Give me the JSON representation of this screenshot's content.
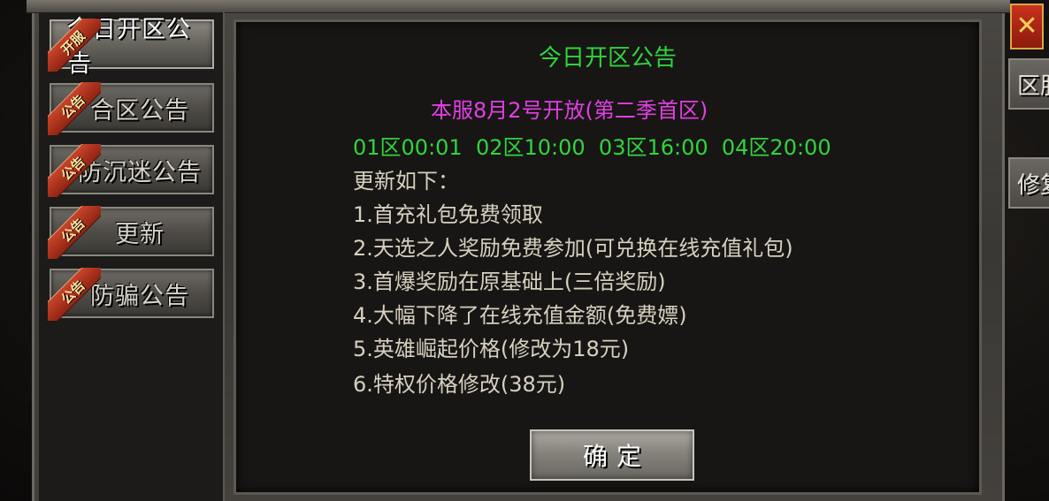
{
  "sidebar": {
    "tabs": [
      {
        "badge": "开服",
        "label": "今日开区公告",
        "active": true
      },
      {
        "badge": "公告",
        "label": "合区公告",
        "active": false
      },
      {
        "badge": "公告",
        "label": "防沉迷公告",
        "active": false
      },
      {
        "badge": "公告",
        "label": "更新",
        "active": false
      },
      {
        "badge": "公告",
        "label": "防骗公告",
        "active": false
      }
    ]
  },
  "panel": {
    "title": "今日开区公告",
    "headline": "本服8月2号开放(第二季首区)",
    "schedule": "01区00:01  02区10:00  03区16:00  04区20:00",
    "body": [
      "更新如下：",
      "1.首充礼包免费领取",
      "2.天选之人奖励免费参加(可兑换在线充值礼包)",
      "3.首爆奖励在原基础上(三倍奖励)",
      "4.大幅下降了在线充值金额(免费嫖)",
      "5.英雄崛起价格(修改为18元)",
      "6.特权价格修改(38元)"
    ],
    "confirm_label": "确定"
  },
  "right_side": {
    "close_icon": "close-icon",
    "buttons": [
      "区服",
      "修复"
    ]
  },
  "colors": {
    "title_green": "#2fd43f",
    "headline_magenta": "#e23fe3",
    "body_text": "#d8d0bf",
    "ribbon_red": "#c9432a"
  }
}
